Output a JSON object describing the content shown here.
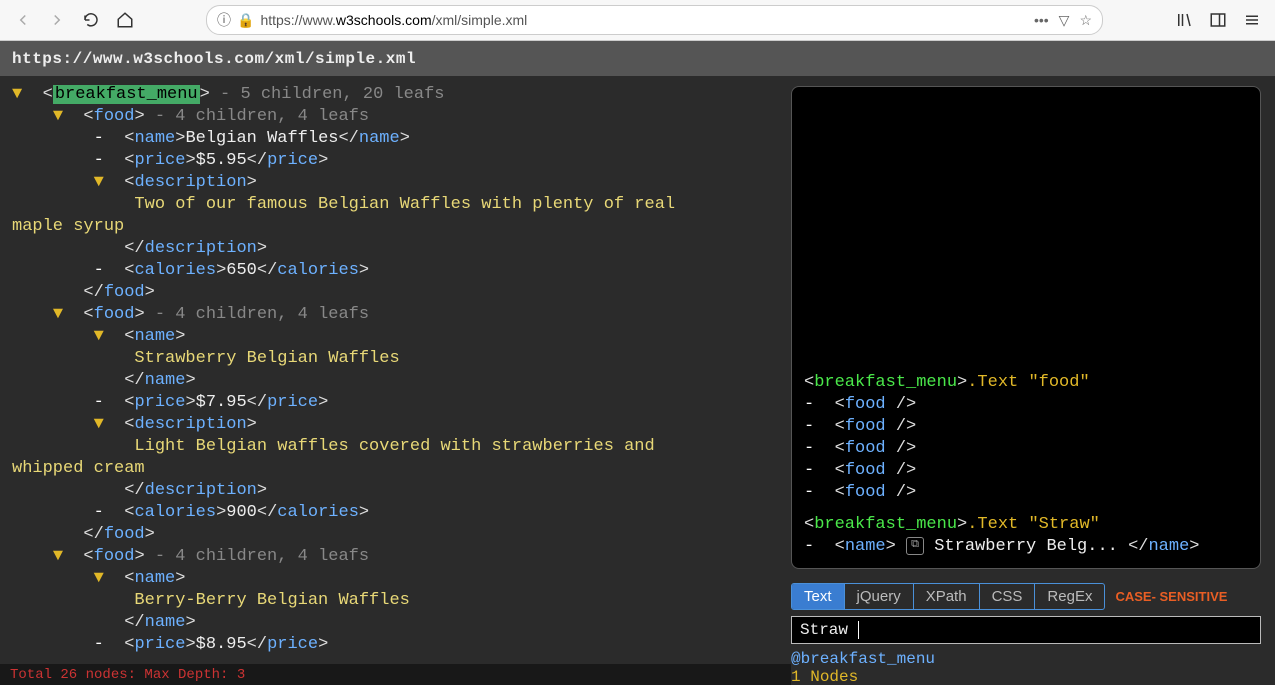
{
  "browser": {
    "url_display_prefix": "https://www.",
    "url_domain": "w3schools.com",
    "url_path": "/xml/simple.xml"
  },
  "header": {
    "title": "https://www.w3schools.com/xml/simple.xml"
  },
  "tree": {
    "root_tag": "breakfast_menu",
    "root_meta": "- 5 children, 20 leafs",
    "food_meta": "- 4 children, 4 leafs",
    "items": [
      {
        "name": "Belgian Waffles",
        "price": "$5.95",
        "description": "Two of our famous Belgian Waffles with plenty of real\nmaple syrup",
        "calories": "650"
      },
      {
        "name": "Strawberry Belgian Waffles",
        "price": "$7.95",
        "description": "Light Belgian waffles covered with strawberries and\nwhipped cream",
        "calories": "900"
      },
      {
        "name": "Berry-Berry Belgian Waffles",
        "price": "$8.95"
      }
    ],
    "el": {
      "food": "food",
      "name": "name",
      "price": "price",
      "description": "description",
      "calories": "calories"
    }
  },
  "results": {
    "q1": {
      "root": "breakfast_menu",
      "op": ".Text",
      "arg": "food",
      "matches": [
        "food",
        "food",
        "food",
        "food",
        "food"
      ]
    },
    "q2": {
      "root": "breakfast_menu",
      "op": ".Text",
      "arg": "Straw",
      "tag": "name",
      "text": "Strawberry Belg..."
    }
  },
  "tabs": {
    "items": [
      "Text",
      "jQuery",
      "XPath",
      "CSS",
      "RegEx"
    ],
    "active": 0,
    "case_label": "CASE-\nSENSITIVE"
  },
  "query_input": "Straw",
  "summary": {
    "scope": "@breakfast_menu",
    "count": "1",
    "label": "Nodes"
  },
  "footer": "Total 26 nodes: Max Depth: 3"
}
